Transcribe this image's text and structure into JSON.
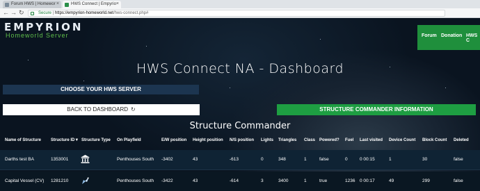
{
  "browser": {
    "tabs": [
      {
        "title": "Forum HWS | Homewor",
        "active": false
      },
      {
        "title": "HWS Connect | Empyrio",
        "active": true
      }
    ],
    "secure_label": "Secure",
    "url_host": "https://empyrion-homeworld.net",
    "url_path": "/hws-connect.php#"
  },
  "site": {
    "logo": "EMPYRION",
    "logo_sub": "Homeworld Server",
    "nav": [
      "Forum",
      "Donation",
      "HWS C"
    ],
    "page_title": "HWS Connect NA - Dashboard",
    "choose_server": "CHOOSE YOUR HWS SERVER",
    "back_button": "BACK TO DASHBOARD",
    "structure_commander_button": "STRUCTURE COMMANDER INFORMATION",
    "section_title": "Structure Commander"
  },
  "table": {
    "columns": [
      "Name of Structure",
      "Structure ID▼",
      "Structure Type",
      "On Playfield",
      "E/W position",
      "Height position",
      "N/S position",
      "Lights",
      "Triangles",
      "Class",
      "Powered?",
      "Fuel",
      "Last visited",
      "Device Count",
      "Block Count",
      "Deleted"
    ],
    "rows": [
      {
        "name": "Darths test BA",
        "id": "1353001",
        "type_icon": "base-icon",
        "playfield": "Penthouses South",
        "ew": "-3402",
        "height": "43",
        "ns": "-613",
        "lights": "0",
        "triangles": "348",
        "class": "1",
        "powered": "false",
        "fuel": "0",
        "last_visited": "0 00:15",
        "device_count": "1",
        "block_count": "30",
        "deleted": "false"
      },
      {
        "name": "Capital Vessel (CV)",
        "id": "1281210",
        "type_icon": "ship-icon",
        "playfield": "Penthouses South",
        "ew": "-3422",
        "height": "43",
        "ns": "-614",
        "lights": "3",
        "triangles": "3400",
        "class": "1",
        "powered": "true",
        "fuel": "1236",
        "last_visited": "0 00:17",
        "device_count": "49",
        "block_count": "299",
        "deleted": "false"
      }
    ]
  },
  "colors": {
    "accent_green": "#1e9e42",
    "nav_green": "#1f8f3c",
    "dark_blue": "#1c3550"
  }
}
